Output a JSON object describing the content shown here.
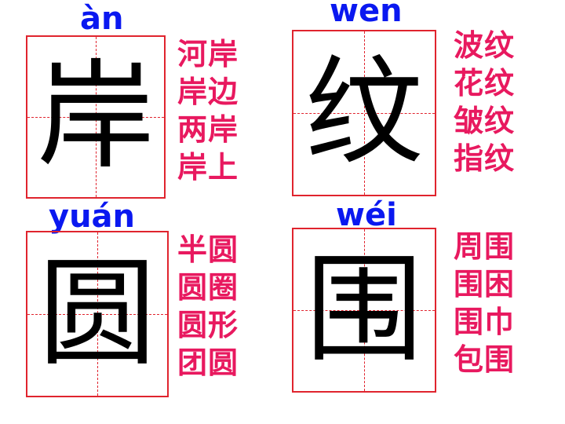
{
  "cards": [
    {
      "pinyin": "àn",
      "character": "岸",
      "words": [
        "河岸",
        "岸边",
        "两岸",
        "岸上"
      ]
    },
    {
      "pinyin": "wen",
      "character": "纹",
      "words": [
        "波纹",
        "花纹",
        "皱纹",
        "指纹"
      ]
    },
    {
      "pinyin": "yuán",
      "character": "圆",
      "words": [
        "半圆",
        "圆圈",
        "圆形",
        "团圆"
      ]
    },
    {
      "pinyin": "wéi",
      "character": "围",
      "words": [
        "周围",
        "围困",
        "围巾",
        "包围"
      ]
    }
  ],
  "colors": {
    "pinyin": "#0a18f0",
    "words": "#e8195f",
    "grid": "#e0242e",
    "character": "#000000"
  }
}
